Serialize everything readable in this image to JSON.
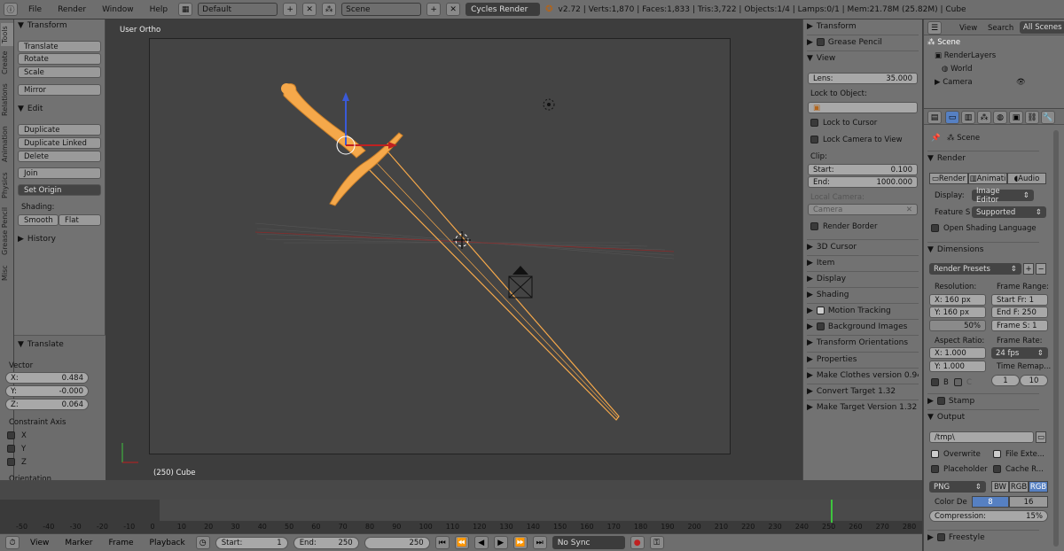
{
  "topbar": {
    "menus": [
      "File",
      "Render",
      "Window",
      "Help"
    ],
    "screen_layout": "Default",
    "scene": "Scene",
    "render_engine": "Cycles Render",
    "stats": "v2.72 | Verts:1,870 | Faces:1,833 | Tris:3,722 | Objects:1/4 | Lamps:0/1 | Mem:21.78M (25.82M) | Cube"
  },
  "left_tabs": [
    "Tools",
    "Create",
    "Relations",
    "Animation",
    "Physics",
    "Grease Pencil",
    "Misc"
  ],
  "toolshelf": {
    "transform_header": "Transform",
    "translate": "Translate",
    "rotate": "Rotate",
    "scale": "Scale",
    "mirror": "Mirror",
    "edit_header": "Edit",
    "duplicate": "Duplicate",
    "duplicate_linked": "Duplicate Linked",
    "delete": "Delete",
    "join": "Join",
    "set_origin": "Set Origin",
    "shading_label": "Shading:",
    "smooth": "Smooth",
    "flat": "Flat",
    "history_header": "History",
    "operator_header": "Translate",
    "vector_label": "Vector",
    "x_label": "X:",
    "x_value": "0.484",
    "y_label": "Y:",
    "y_value": "-0.000",
    "z_label": "Z:",
    "z_value": "0.064",
    "constraint_label": "Constraint Axis",
    "axis_x": "X",
    "axis_y": "Y",
    "axis_z": "Z",
    "orientation_label": "Orientation"
  },
  "viewport": {
    "view_name": "User Ortho",
    "status": "(250) Cube"
  },
  "npanel": {
    "transform": "Transform",
    "grease_pencil": "Grease Pencil",
    "view": "View",
    "lens_label": "Lens:",
    "lens_value": "35.000",
    "lock_object_label": "Lock to Object:",
    "lock_cursor": "Lock to Cursor",
    "lock_camera": "Lock Camera to View",
    "clip_label": "Clip:",
    "start_label": "Start:",
    "start_value": "0.100",
    "end_label": "End:",
    "end_value": "1000.000",
    "local_camera_label": "Local Camera:",
    "camera": "Camera",
    "render_border": "Render Border",
    "cursor_3d": "3D Cursor",
    "item": "Item",
    "display": "Display",
    "shading": "Shading",
    "motion_tracking": "Motion Tracking",
    "background_images": "Background Images",
    "transform_orientations": "Transform Orientations",
    "properties": "Properties",
    "make_clothes": "Make Clothes version 0.949",
    "convert_target": "Convert Target 1.32",
    "make_target": "Make Target  Version 1.32"
  },
  "outliner": {
    "view": "View",
    "search": "Search",
    "all_scenes": "All Scenes",
    "items": [
      "Scene",
      "RenderLayers",
      "World",
      "Camera"
    ]
  },
  "properties": {
    "scene": "Scene",
    "render_header": "Render",
    "render_btn": "Render",
    "animation_btn": "Animati",
    "audio_btn": "Audio",
    "display_label": "Display:",
    "display_value": "Image Editor",
    "feature_label": "Feature S",
    "feature_value": "Supported",
    "open_shading": "Open Shading Language",
    "dimensions_header": "Dimensions",
    "render_presets": "Render Presets",
    "resolution_label": "Resolution:",
    "res_x": "X: 160 px",
    "res_y": "Y: 160 px",
    "res_pct": "50%",
    "frame_range_label": "Frame Range:",
    "start_fr": "Start Fr: 1",
    "end_fr": "End F: 250",
    "frame_step": "Frame S: 1",
    "aspect_label": "Aspect Ratio:",
    "asp_x": "X:  1.000",
    "asp_y": "Y:  1.000",
    "frame_rate_label": "Frame Rate:",
    "fps": "24 fps",
    "time_remap": "Time Remap...",
    "remap_old": "1",
    "remap_new": "10",
    "border_b": "B",
    "border_c": "C",
    "stamp": "Stamp",
    "output_header": "Output",
    "output_path": "/tmp\\",
    "overwrite": "Overwrite",
    "file_ext": "File Exte...",
    "placeholder": "Placeholder",
    "cache_r": "Cache R...",
    "format": "PNG",
    "bw": "BW",
    "rgb": "RGB",
    "rgba": "RGB",
    "color_depth_label": "Color De",
    "depth_8": "8",
    "depth_16": "16",
    "compression": "Compression:",
    "compression_value": "15%",
    "freestyle": "Freestyle"
  },
  "timeline": {
    "ticks": [
      "-50",
      "-40",
      "-30",
      "-20",
      "-10",
      "0",
      "10",
      "20",
      "30",
      "40",
      "50",
      "60",
      "70",
      "80",
      "90",
      "100",
      "110",
      "120",
      "130",
      "140",
      "150",
      "160",
      "170",
      "180",
      "190",
      "200",
      "210",
      "220",
      "230",
      "240",
      "250",
      "260",
      "270",
      "280"
    ],
    "view": "View",
    "marker": "Marker",
    "frame": "Frame",
    "playback": "Playback",
    "start_label": "Start:",
    "start_value": "1",
    "end_label": "End:",
    "end_value": "250",
    "current": "250",
    "sync": "No Sync"
  },
  "colors": {
    "sword": "#f5a84a",
    "selected_tab": "#5680c2",
    "frame_marker": "#3ec43e"
  }
}
